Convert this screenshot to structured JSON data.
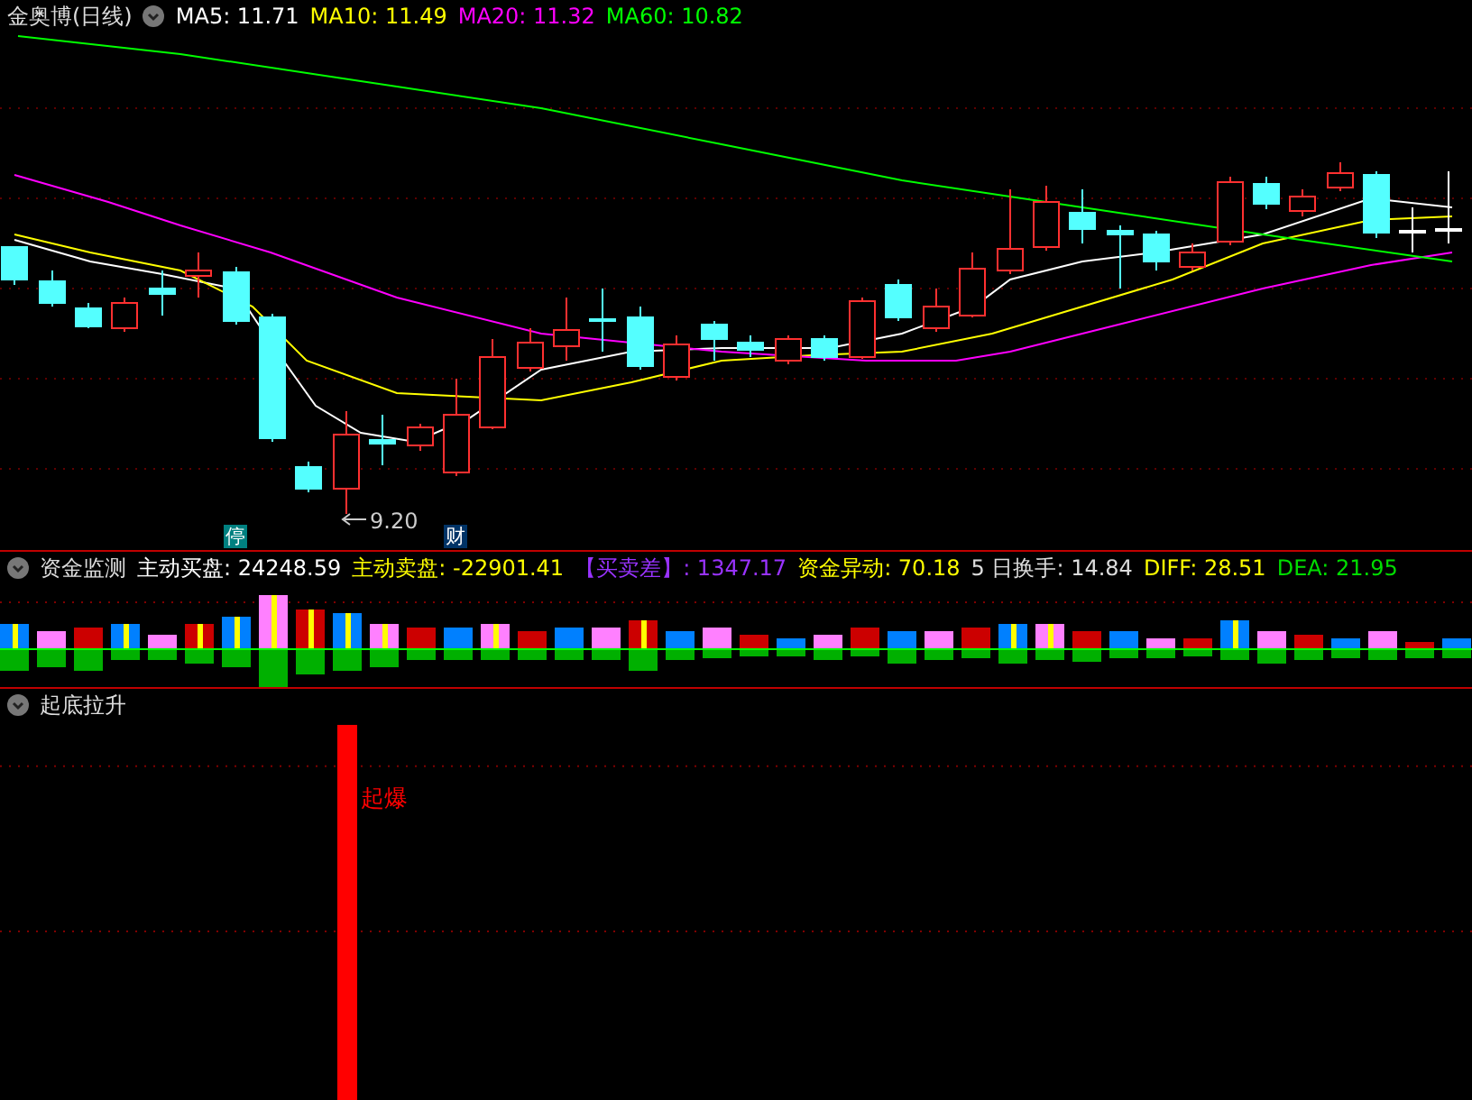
{
  "stock": {
    "name": "金奥博(日线)"
  },
  "ma_legend": [
    {
      "label": "MA5: 11.71",
      "color": "#ffffff"
    },
    {
      "label": "MA10: 11.49",
      "color": "#ffff00"
    },
    {
      "label": "MA20: 11.32",
      "color": "#ff00ff"
    },
    {
      "label": "MA60: 10.82",
      "color": "#00ff00"
    }
  ],
  "main_chart": {
    "low_label": "9.20",
    "markers": [
      {
        "text": "停",
        "color": "#008080"
      },
      {
        "text": "财",
        "color": "#003366"
      }
    ]
  },
  "fund_panel": {
    "title": "资金监测",
    "metrics": [
      {
        "label": "主动买盘: 24248.59",
        "color": "#ffffff"
      },
      {
        "label": "主动卖盘: -22901.41",
        "color": "#ffff00"
      },
      {
        "label": "【买卖差】: 1347.17",
        "color": "#9933ff"
      },
      {
        "label": "资金异动: 70.18",
        "color": "#ffff00"
      },
      {
        "label": "5 日换手: 14.84",
        "color": "#dddddd"
      },
      {
        "label": "DIFF: 28.51",
        "color": "#ffff00"
      },
      {
        "label": "DEA: 21.95",
        "color": "#00dd00"
      }
    ]
  },
  "signal_panel": {
    "title": "起底拉升",
    "signal_label": "起爆"
  }
}
